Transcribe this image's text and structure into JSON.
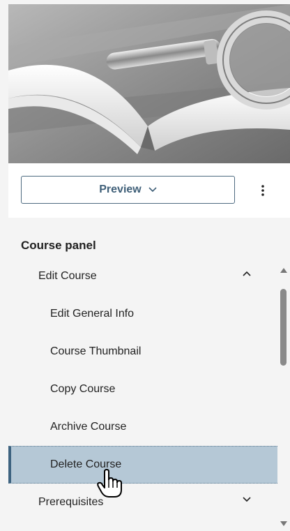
{
  "course_card": {
    "thumbnail_alt": "book-and-magnifying-glass-photo",
    "preview_label": "Preview",
    "more_options_icon": "vertical-ellipsis-icon"
  },
  "course_panel": {
    "title": "Course panel",
    "items": [
      {
        "label": "Edit Course",
        "level": 1,
        "expanded": true
      },
      {
        "label": "Edit General Info",
        "level": 2
      },
      {
        "label": "Course Thumbnail",
        "level": 2
      },
      {
        "label": "Copy Course",
        "level": 2
      },
      {
        "label": "Archive Course",
        "level": 2
      },
      {
        "label": "Delete Course",
        "level": 2,
        "selected": true
      },
      {
        "label": "Prerequisites",
        "level": 1,
        "expanded": false
      }
    ]
  },
  "colors": {
    "accent": "#3f5f78",
    "selected_bg": "#b5c8d6",
    "selected_bar": "#3e6380",
    "panel_bg": "#f4f4f4"
  }
}
